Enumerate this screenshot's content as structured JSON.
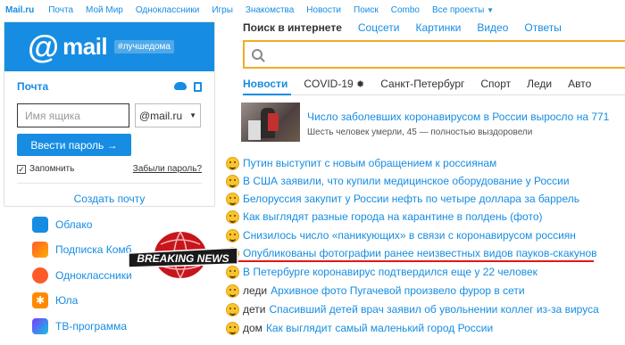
{
  "topbar": {
    "logo": "Mail.ru",
    "items": [
      "Почта",
      "Мой Мир",
      "Одноклассники",
      "Игры",
      "Знакомства",
      "Новости",
      "Поиск",
      "Combo",
      "Все проекты"
    ]
  },
  "login": {
    "logo_word": "mail",
    "logo_at": "@",
    "hashtag": "#лучшедома",
    "mail_label": "Почта",
    "username_placeholder": "Имя ящика",
    "domain": "@mail.ru",
    "submit": "Ввести пароль →",
    "remember": "Запомнить",
    "forgot": "Забыли пароль?",
    "create": "Создать почту"
  },
  "services": [
    "Облако",
    "Подписка Комб",
    "Одноклассники",
    "Юла",
    "ТВ-программа"
  ],
  "search": {
    "tabs": [
      "Поиск в интернете",
      "Соцсети",
      "Картинки",
      "Видео",
      "Ответы"
    ]
  },
  "news_tabs": [
    "Новости",
    "COVID-19",
    "Санкт-Петербург",
    "Спорт",
    "Леди",
    "Авто"
  ],
  "lead": {
    "title": "Число заболевших коронавирусом в России выросло на 771",
    "subtitle": "Шесть человек умерли, 45 — полностью выздоровели"
  },
  "news": [
    {
      "prefix": "",
      "text": "Путин выступит с новым обращением к россиянам"
    },
    {
      "prefix": "",
      "text": "В США заявили, что купили медицинское оборудование у России"
    },
    {
      "prefix": "",
      "text": "Белоруссия закупит у России нефть по четыре доллара за баррель"
    },
    {
      "prefix": "",
      "text": "Как выглядят разные города на карантине в полдень (фото)"
    },
    {
      "prefix": "",
      "text": "Снизилось число «паникующих» в связи с коронавирусом россиян"
    },
    {
      "prefix": "",
      "text": "Опубликованы фотографии ранее неизвестных видов пауков-скакунов"
    },
    {
      "prefix": "",
      "text": "В Петербурге коронавирус подтвердился еще у 22 человек"
    },
    {
      "prefix": "леди",
      "text": "Архивное фото Пугачевой произвело фурор в сети"
    },
    {
      "prefix": "дети",
      "text": "Спасивший детей врач заявил об увольнении коллег из-за вируса"
    },
    {
      "prefix": "дом",
      "text": "Как выглядит самый маленький город России"
    }
  ],
  "badge": {
    "text": "BREAKING NEWS"
  },
  "colors": {
    "accent": "#168de2",
    "search_border": "#f2ac22",
    "badge_red": "#c8151b"
  }
}
